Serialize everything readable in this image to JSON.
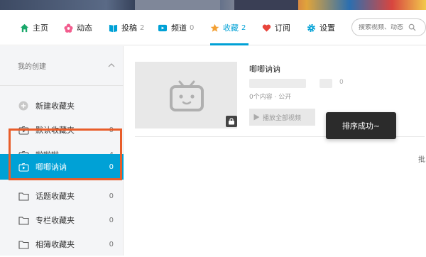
{
  "nav": {
    "items": [
      {
        "label": "主页",
        "icon": "home-icon",
        "count": ""
      },
      {
        "label": "动态",
        "icon": "flower-icon",
        "count": ""
      },
      {
        "label": "投稿",
        "icon": "book-icon",
        "count": "2"
      },
      {
        "label": "频道",
        "icon": "tv-icon",
        "count": "0"
      },
      {
        "label": "收藏",
        "icon": "star-icon",
        "count": "2"
      },
      {
        "label": "订阅",
        "icon": "heart-icon",
        "count": ""
      },
      {
        "label": "设置",
        "icon": "gear-icon",
        "count": ""
      }
    ],
    "active_index": 4,
    "search_placeholder": "搜索视频、动态"
  },
  "sidebar": {
    "section_title": "我的创建",
    "items": [
      {
        "label": "新建收藏夹",
        "count": "",
        "icon": "plus-circle-icon"
      },
      {
        "label": "默认收藏夹",
        "count": "0",
        "icon": "folder-tv-icon"
      },
      {
        "label": "啦啦啦",
        "count": "4",
        "icon": "folder-tv-icon"
      },
      {
        "label": "唧唧讷讷",
        "count": "0",
        "icon": "folder-tv-icon"
      },
      {
        "label": "话题收藏夹",
        "count": "0",
        "icon": "folder-icon"
      },
      {
        "label": "专栏收藏夹",
        "count": "0",
        "icon": "folder-icon"
      },
      {
        "label": "相簿收藏夹",
        "count": "0",
        "icon": "folder-icon"
      }
    ],
    "selected_index": 3
  },
  "main": {
    "folder_title": "唧唧讷讷",
    "blurred_count": "0",
    "meta": "0个内容 · 公开",
    "play_all_label": "播放全部视频",
    "right_edge_text": "批"
  },
  "toast": {
    "message": "排序成功~"
  },
  "colors": {
    "accent": "#00a1d6",
    "highlight_border": "#e85d2a",
    "toast_bg": "#2b2b2b"
  }
}
